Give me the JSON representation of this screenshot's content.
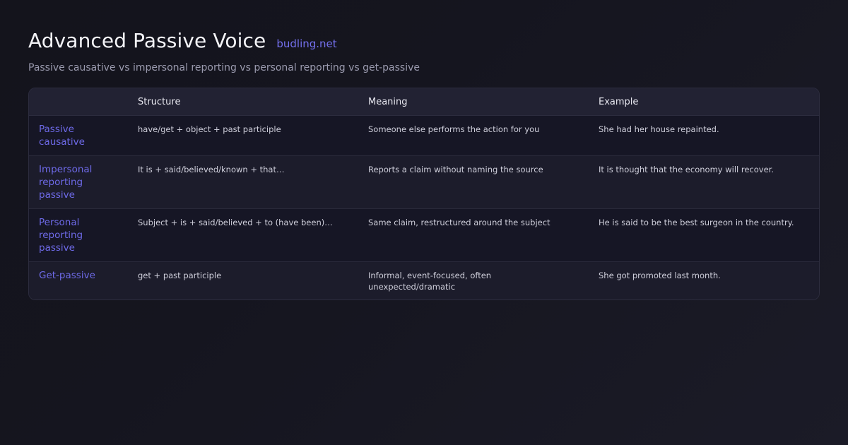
{
  "header": {
    "title": "Advanced Passive Voice",
    "brand": "budling.net",
    "subtitle": "Passive causative vs impersonal reporting vs personal reporting vs get-passive"
  },
  "table": {
    "columns": [
      "",
      "Structure",
      "Meaning",
      "Example"
    ],
    "rows": [
      {
        "label": "Passive causative",
        "structure": "have/get + object + past participle",
        "meaning": "Someone else performs the action for you",
        "example": "She had her house repainted."
      },
      {
        "label": "Impersonal reporting passive",
        "structure": "It is + said/believed/known + that…",
        "meaning": "Reports a claim without naming the source",
        "example": "It is thought that the economy will recover."
      },
      {
        "label": "Personal reporting passive",
        "structure": "Subject + is + said/believed + to (have been)…",
        "meaning": "Same claim, restructured around the subject",
        "example": "He is said to be the best surgeon in the country."
      },
      {
        "label": "Get-passive",
        "structure": "get + past participle",
        "meaning": "Informal, event-focused, often unexpected/dramatic",
        "example": "She got promoted last month."
      }
    ]
  }
}
